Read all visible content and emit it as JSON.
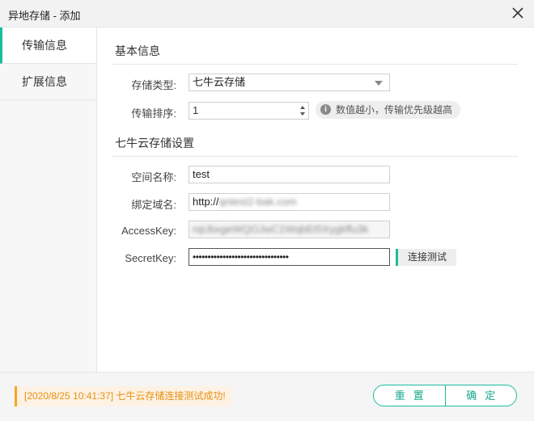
{
  "window": {
    "title": "异地存储 - 添加"
  },
  "sidebar": {
    "tabs": [
      {
        "label": "传输信息"
      },
      {
        "label": "扩展信息"
      }
    ]
  },
  "basic": {
    "section_title": "基本信息",
    "storage_type_label": "存储类型:",
    "storage_type_value": "七牛云存储",
    "priority_label": "传输排序:",
    "priority_value": "1",
    "hint": "数值越小，传输优先级越高"
  },
  "qiniu": {
    "section_title": "七牛云存储设置",
    "space_label": "空间名称:",
    "space_value": "test",
    "domain_label": "绑定域名:",
    "domain_prefix": "http://",
    "domain_blurred": "qntest2-bak.com",
    "accesskey_label": "AccessKey:",
    "accesskey_value": "rqUbxgeWQOJwC1WqbEt5Xygkffu3k",
    "secretkey_label": "SecretKey:",
    "secretkey_value": "••••••••••••••••••••••••••••••••",
    "test_button": "连接测试"
  },
  "footer": {
    "status": "[2020/8/25  10:41:37] 七牛云存储连接测试成功!",
    "reset_button": "重置",
    "confirm_button": "确定"
  },
  "colors": {
    "accent": "#1abc9c",
    "warning": "#e8900f"
  },
  "icons": {
    "close": "close-icon",
    "info": "info-icon",
    "dropdown": "chevron-down-icon"
  }
}
